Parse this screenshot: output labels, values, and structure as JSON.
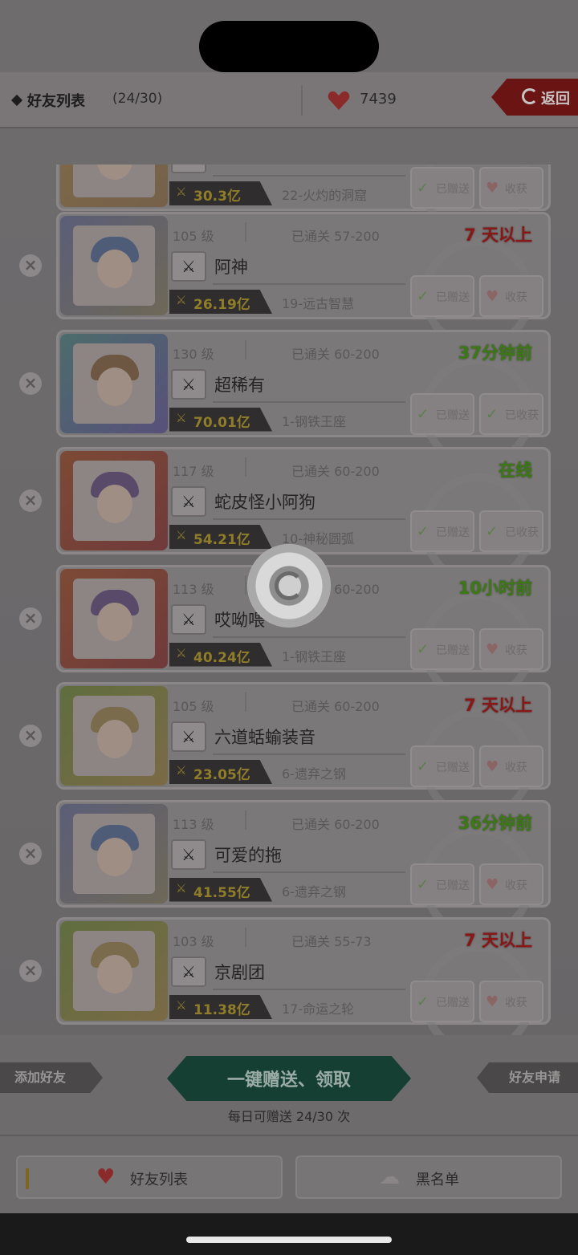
{
  "header": {
    "title": "好友列表",
    "count": "(24/30)",
    "hearts": "7439",
    "back_label": "返回"
  },
  "friends": [
    {
      "level": "",
      "stage": "",
      "last_seen": "",
      "name": "",
      "power": "30.3亿",
      "guild": "22-火灼的洞窟",
      "send": "已赠送",
      "recv": "收获",
      "frame": "gold"
    },
    {
      "level": "105 级",
      "stage": "已通关 57-200",
      "last_seen": "7 天以上",
      "status_color": "red",
      "name": "阿神",
      "power": "26.19亿",
      "guild": "19-远古智慧",
      "send": "已赠送",
      "recv": "收获",
      "frame": "blue"
    },
    {
      "level": "130 级",
      "stage": "已通关 60-200",
      "last_seen": "37分钟前",
      "status_color": "green",
      "name": "超稀有",
      "power": "70.01亿",
      "guild": "1-钢铁王座",
      "send": "已赠送",
      "recv": "已收获",
      "frame": "teal"
    },
    {
      "level": "117 级",
      "stage": "已通关 60-200",
      "last_seen": "在线",
      "status_color": "green",
      "name": "蛇皮怪小阿狗",
      "power": "54.21亿",
      "guild": "10-神秘圆弧",
      "send": "已赠送",
      "recv": "已收获",
      "frame": "red"
    },
    {
      "level": "113 级",
      "stage": "已通关 60-200",
      "last_seen": "10小时前",
      "status_color": "green",
      "name": "哎呦喂",
      "power": "40.24亿",
      "guild": "1-钢铁王座",
      "send": "已赠送",
      "recv": "收获",
      "frame": "red"
    },
    {
      "level": "105 级",
      "stage": "已通关 60-200",
      "last_seen": "7 天以上",
      "status_color": "red",
      "name": "六道蛞蝓装音",
      "power": "23.05亿",
      "guild": "6-遗弃之钢",
      "send": "已赠送",
      "recv": "收获",
      "frame": "green"
    },
    {
      "level": "113 级",
      "stage": "已通关 60-200",
      "last_seen": "36分钟前",
      "status_color": "green",
      "name": "可爱的拖",
      "power": "41.55亿",
      "guild": "6-遗弃之钢",
      "send": "已赠送",
      "recv": "收获",
      "frame": "blue"
    },
    {
      "level": "103 级",
      "stage": "已通关 55-73",
      "last_seen": "7 天以上",
      "status_color": "red",
      "name": "京剧团",
      "power": "11.38亿",
      "guild": "17-命运之轮",
      "send": "已赠送",
      "recv": "收获",
      "frame": "green"
    }
  ],
  "actions": {
    "add_friend": "添加好友",
    "one_click": "一键赠送、领取",
    "friend_requests": "好友申请",
    "daily_note": "每日可赠送 24/30 次"
  },
  "tabs": {
    "friends": "好友列表",
    "blacklist": "黑名单"
  },
  "icons": {
    "weapon": "crossed-swords-icon",
    "heart": "heart-icon",
    "remove": "close-icon",
    "loading": "loading-spinner-icon"
  },
  "colors": {
    "overlay_gray": "#6e6c6d",
    "offline_red": "#8a1616",
    "online_green": "#3b7a12",
    "main_button": "#163f33"
  }
}
